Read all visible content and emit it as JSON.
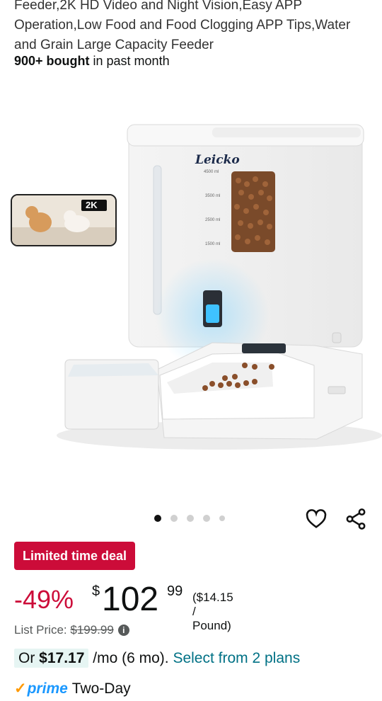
{
  "product": {
    "title_line1": "Feeder,2K HD Video and Night Vision,Easy APP",
    "title_line2": "Operation,Low Food and Food Clogging APP Tips,Water",
    "title_line3": "and Grain Large Capacity Feeder",
    "bought_bold": "900+ bought",
    "bought_rest": " in past month",
    "brand": "Leicko",
    "badge_2k": "2K",
    "scale": [
      "4500 ml",
      "3500 ml",
      "2500 ml",
      "1500 ml"
    ]
  },
  "carousel": {
    "total": 5,
    "active": 1
  },
  "icons": {
    "wishlist": "heart-icon",
    "share": "share-icon",
    "info": "info-icon"
  },
  "deal": {
    "label": "Limited time deal",
    "color": "#CC0C39"
  },
  "price": {
    "discount": "-49%",
    "currency": "$",
    "whole": "102",
    "fraction": "99",
    "unit_price": "($14.15 / Pound)"
  },
  "list_price": {
    "label": "List Price: ",
    "value": "$199.99"
  },
  "monthly": {
    "prefix": "Or ",
    "amount": "$17.17",
    "terms": " /mo (6 mo). ",
    "link": "Select from 2 plans"
  },
  "prime": {
    "check": "✓",
    "word": "prime",
    "delivery": "Two-Day"
  }
}
